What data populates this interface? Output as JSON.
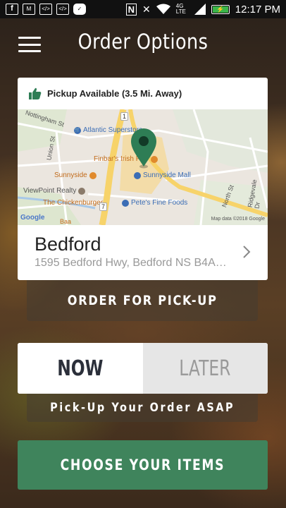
{
  "status_bar": {
    "time": "12:17 PM",
    "network": "4G LTE",
    "icons": [
      "facebook-icon",
      "gmail-icon",
      "code-icon",
      "code-icon",
      "chat-icon",
      "nfc-icon",
      "mute-icon",
      "wifi-icon",
      "signal-icon",
      "battery-icon"
    ]
  },
  "header": {
    "title": "Order Options",
    "menu_icon": "hamburger-icon"
  },
  "location_card": {
    "pickup_status": "Pickup Available (3.5 Mi. Away)",
    "pickup_icon": "thumbs-up-icon",
    "map": {
      "labels": {
        "nottingham": "Nottingham St",
        "union": "Union St",
        "atlantic": "Atlantic Superstore",
        "finbars": "Finbar's Irish Pub",
        "sunnyside": "Sunnyside",
        "sunnyside_mall": "Sunnyside Mall",
        "viewpoint": "ViewPoint Realty",
        "chickenburger": "The Chickenburger",
        "petes": "Pete's Fine Foods",
        "north_st": "North St",
        "ridgevale": "Ridgevale Dr",
        "route1": "1",
        "route7": "7",
        "bedford_bar": "Baa",
        "google": "Google",
        "attribution": "Map data ©2018 Google"
      },
      "pin_color": "#2e7d55"
    },
    "store_name": "Bedford",
    "store_address": "1595 Bedford Hwy, Bedford NS B4A…"
  },
  "order_for_pickup_label": "ORDER FOR PICK-UP",
  "timing": {
    "now_label": "NOW",
    "later_label": "LATER",
    "selected": "NOW",
    "description": "Pick-Up Your Order ASAP"
  },
  "choose_items_label": "CHOOSE YOUR ITEMS",
  "colors": {
    "accent_green": "#3f845c",
    "pin_green": "#2e7d55"
  }
}
